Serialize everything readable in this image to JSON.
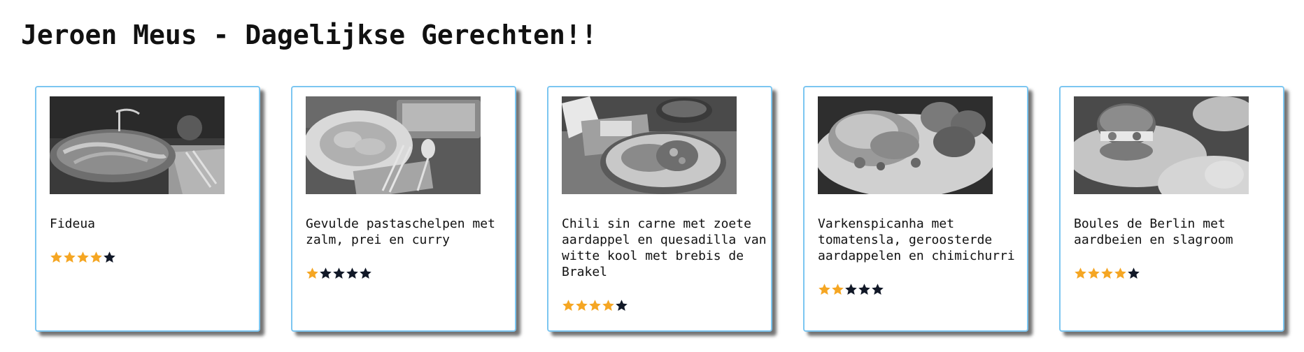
{
  "page": {
    "title": "Jeroen Meus - Dagelijkse Gerechten!!"
  },
  "colors": {
    "card_border": "#7cc6f1",
    "star_filled": "#f5a623",
    "star_empty": "#111827"
  },
  "recipes": [
    {
      "title": "Fideua",
      "rating": 4,
      "max_rating": 5,
      "image_icon": "paella-pan-photo"
    },
    {
      "title": "Gevulde pastaschelpen met zalm, prei en curry",
      "rating": 1,
      "max_rating": 5,
      "image_icon": "pasta-plate-photo"
    },
    {
      "title": "Chili sin carne met zoete aardappel en quesadilla van witte kool met brebis de Brakel",
      "rating": 4,
      "max_rating": 5,
      "image_icon": "chili-plate-photo"
    },
    {
      "title": "Varkenspicanha met tomatensla, geroosterde aardappelen en chimichurri",
      "rating": 2,
      "max_rating": 5,
      "image_icon": "pork-plate-photo"
    },
    {
      "title": "Boules de Berlin met aardbeien en slagroom",
      "rating": 4,
      "max_rating": 5,
      "image_icon": "pastry-plate-photo"
    }
  ]
}
